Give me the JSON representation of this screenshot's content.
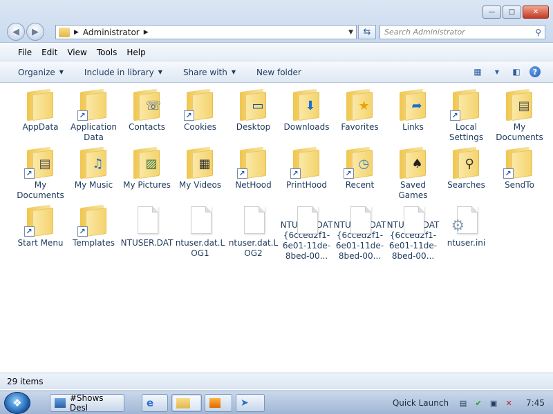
{
  "window": {
    "controls": {
      "minimize": "—",
      "maximize": "□",
      "close": "✕"
    }
  },
  "address": {
    "crumb": "Administrator",
    "search_placeholder": "Search Administrator"
  },
  "menu": [
    "File",
    "Edit",
    "View",
    "Tools",
    "Help"
  ],
  "commands": {
    "organize": "Organize",
    "include_in_library": "Include in library",
    "share_with": "Share with",
    "new_folder": "New folder"
  },
  "items": [
    {
      "label": "AppData",
      "icon": "folder-icon",
      "shortcut": false
    },
    {
      "label": "Application Data",
      "icon": "folder-shortcut-icon",
      "shortcut": true
    },
    {
      "label": "Contacts",
      "icon": "contacts-folder-icon",
      "shortcut": false
    },
    {
      "label": "Cookies",
      "icon": "folder-shortcut-icon",
      "shortcut": true
    },
    {
      "label": "Desktop",
      "icon": "desktop-folder-icon",
      "shortcut": false
    },
    {
      "label": "Downloads",
      "icon": "downloads-folder-icon",
      "shortcut": false
    },
    {
      "label": "Favorites",
      "icon": "favorites-folder-icon",
      "shortcut": false
    },
    {
      "label": "Links",
      "icon": "links-folder-icon",
      "shortcut": false
    },
    {
      "label": "Local Settings",
      "icon": "folder-shortcut-icon",
      "shortcut": true
    },
    {
      "label": "My Documents",
      "icon": "documents-folder-icon",
      "shortcut": false
    },
    {
      "label": "My Documents",
      "icon": "documents-folder-shortcut-icon",
      "shortcut": true
    },
    {
      "label": "My Music",
      "icon": "music-folder-icon",
      "shortcut": false
    },
    {
      "label": "My Pictures",
      "icon": "pictures-folder-icon",
      "shortcut": false
    },
    {
      "label": "My Videos",
      "icon": "videos-folder-icon",
      "shortcut": false
    },
    {
      "label": "NetHood",
      "icon": "folder-shortcut-icon",
      "shortcut": true
    },
    {
      "label": "PrintHood",
      "icon": "folder-shortcut-icon",
      "shortcut": true
    },
    {
      "label": "Recent",
      "icon": "recent-shortcut-icon",
      "shortcut": true
    },
    {
      "label": "Saved Games",
      "icon": "saved-games-folder-icon",
      "shortcut": false
    },
    {
      "label": "Searches",
      "icon": "searches-folder-icon",
      "shortcut": false
    },
    {
      "label": "SendTo",
      "icon": "folder-shortcut-icon",
      "shortcut": true
    },
    {
      "label": "Start Menu",
      "icon": "folder-shortcut-icon",
      "shortcut": true
    },
    {
      "label": "Templates",
      "icon": "folder-shortcut-icon",
      "shortcut": true
    },
    {
      "label": "NTUSER.DAT",
      "icon": "file-icon",
      "shortcut": false
    },
    {
      "label": "ntuser.dat.LOG1",
      "icon": "file-icon",
      "shortcut": false
    },
    {
      "label": "ntuser.dat.LOG2",
      "icon": "file-icon",
      "shortcut": false
    },
    {
      "label": "NTUSER.DAT{6cced2f1-6e01-11de-8bed-00...",
      "icon": "file-icon",
      "shortcut": false
    },
    {
      "label": "NTUSER.DAT{6cced2f1-6e01-11de-8bed-00...",
      "icon": "file-icon",
      "shortcut": false
    },
    {
      "label": "NTUSER.DAT{6cced2f1-6e01-11de-8bed-00...",
      "icon": "file-icon",
      "shortcut": false
    },
    {
      "label": "ntuser.ini",
      "icon": "settings-file-icon",
      "shortcut": false
    }
  ],
  "status": {
    "count": "29 items"
  },
  "taskbar": {
    "task1_label": "#Shows Desl",
    "quick_launch": "Quick Launch",
    "clock": "7:45"
  }
}
